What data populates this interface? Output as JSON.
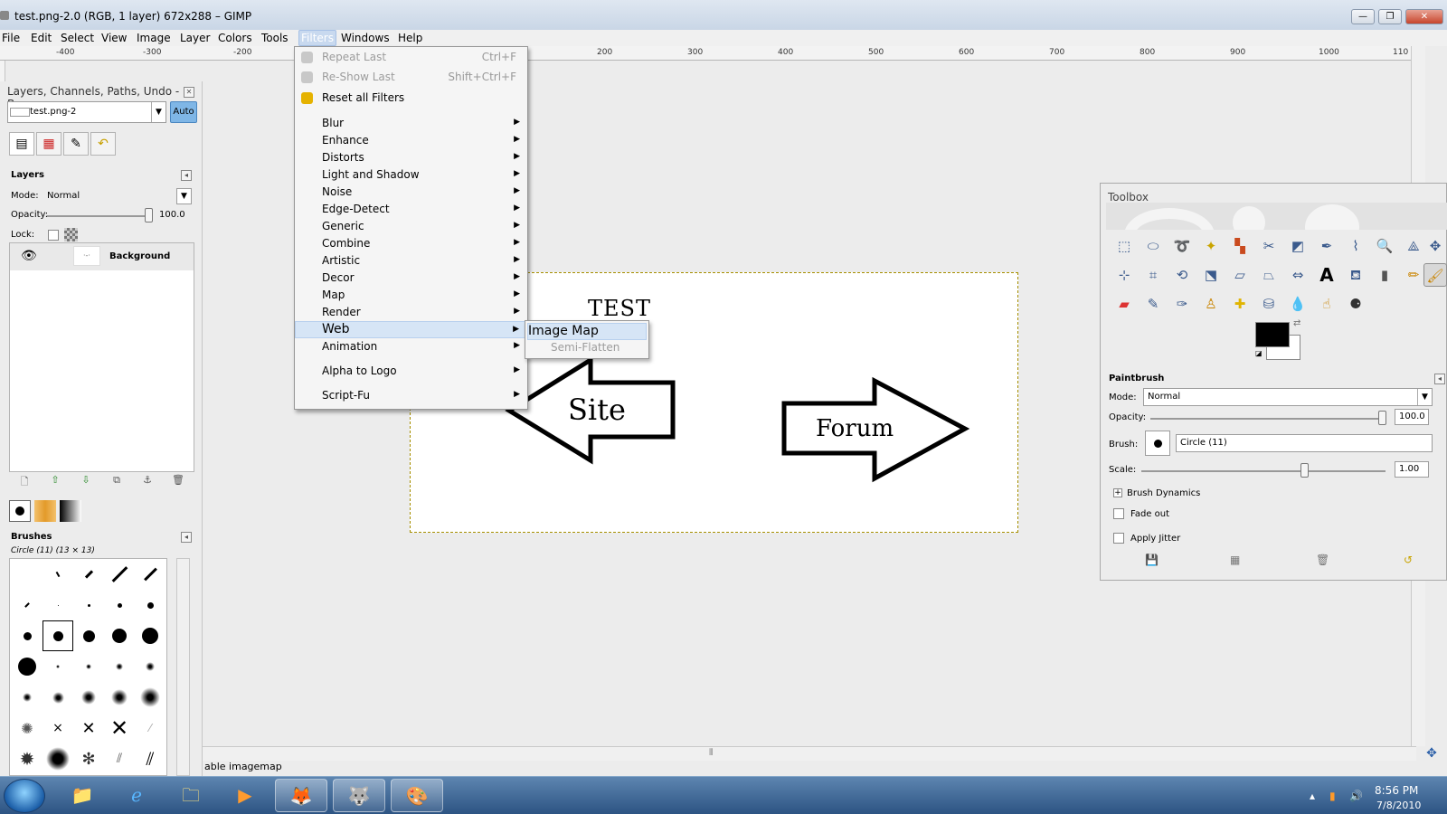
{
  "window": {
    "title": "test.png-2.0 (RGB, 1 layer) 672x288 – GIMP",
    "buttons": {
      "minimize": "—",
      "maximize": "❐",
      "close": "✕"
    }
  },
  "menubar": [
    "File",
    "Edit",
    "Select",
    "View",
    "Image",
    "Layer",
    "Colors",
    "Tools",
    "Filters",
    "Windows",
    "Help"
  ],
  "ruler": {
    "ticks": [
      "-400",
      "-300",
      "-200",
      "200",
      "300",
      "400",
      "500",
      "600",
      "700",
      "800",
      "900",
      "1000",
      "110"
    ]
  },
  "filters_menu": {
    "top": [
      {
        "label": "Repeat Last",
        "shortcut": "Ctrl+F",
        "disabled": true
      },
      {
        "label": "Re-Show Last",
        "shortcut": "Shift+Ctrl+F",
        "disabled": true
      },
      {
        "label": "Reset all Filters",
        "shortcut": "",
        "disabled": false
      }
    ],
    "items": [
      "Blur",
      "Enhance",
      "Distorts",
      "Light and Shadow",
      "Noise",
      "Edge-Detect",
      "Generic",
      "Combine",
      "Artistic",
      "Decor",
      "Map",
      "Render",
      "Web",
      "Animation"
    ],
    "bottom": [
      "Alpha to Logo",
      "Script-Fu"
    ],
    "highlighted": "Web"
  },
  "web_submenu": {
    "items": [
      "Image Map",
      "Semi-Flatten"
    ]
  },
  "image": {
    "title_text": "TEST",
    "arrow_left_text": "Site",
    "arrow_right_text": "Forum"
  },
  "status": {
    "text": "able imagemap"
  },
  "dock": {
    "title": "Layers, Channels, Paths, Undo - Br...",
    "image_select": "test.png-2",
    "auto_button": "Auto",
    "layers": {
      "heading": "Layers",
      "mode_label": "Mode:",
      "mode_value": "Normal",
      "opacity_label": "Opacity:",
      "opacity_value": "100.0",
      "lock_label": "Lock:",
      "layer_name": "Background"
    },
    "brushes": {
      "heading": "Brushes",
      "current": "Circle (11) (13 × 13)"
    }
  },
  "toolbox": {
    "title": "Toolbox",
    "options_heading": "Paintbrush",
    "mode_label": "Mode:",
    "mode_value": "Normal",
    "opacity_label": "Opacity:",
    "opacity_value": "100.0",
    "brush_label": "Brush:",
    "brush_value": "Circle (11)",
    "scale_label": "Scale:",
    "scale_value": "1.00",
    "brush_dynamics": "Brush Dynamics",
    "fade_out": "Fade out",
    "apply_jitter": "Apply Jitter"
  },
  "taskbar": {
    "time": "8:56 PM",
    "date": "7/8/2010"
  }
}
